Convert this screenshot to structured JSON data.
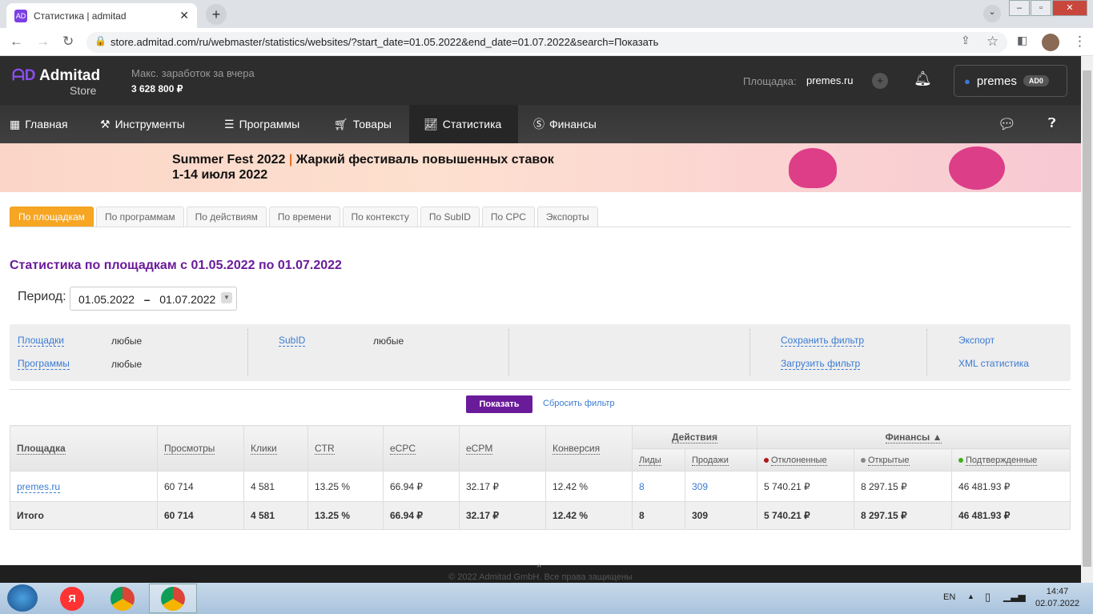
{
  "browser": {
    "tab_title": "Статистика | admitad",
    "url": "store.admitad.com/ru/webmaster/statistics/websites/?start_date=01.05.2022&end_date=01.07.2022&search=Показать"
  },
  "header": {
    "logo": "Admitad",
    "logo_sub": "Store",
    "earn_label": "Макс. заработок за вчера",
    "earn_value": "3 628 800 ₽",
    "site_label": "Площадка:",
    "site_value": "premes.ru",
    "user": "premes",
    "badge": "AD0"
  },
  "nav": [
    {
      "label": "Главная"
    },
    {
      "label": "Инструменты"
    },
    {
      "label": "Программы"
    },
    {
      "label": "Товары"
    },
    {
      "label": "Статистика"
    },
    {
      "label": "Финансы"
    }
  ],
  "banner": {
    "line1a": "Summer Fest 2022",
    "sep": " | ",
    "line1b": "Жаркий фестиваль повышенных ставок",
    "line2": "1-14 июля 2022"
  },
  "tabs": [
    "По площадкам",
    "По программам",
    "По действиям",
    "По времени",
    "По контексту",
    "По SubID",
    "По CPC",
    "Экспорты"
  ],
  "page_title": "Статистика по площадкам с 01.05.2022 по 01.07.2022",
  "period": {
    "label": "Период:",
    "from": "01.05.2022",
    "dash": "–",
    "to": "01.07.2022"
  },
  "filter": {
    "sites": "Площадки",
    "sites_val": "любые",
    "programs": "Программы",
    "programs_val": "любые",
    "subid": "SubID",
    "subid_val": "любые",
    "save": "Сохранить фильтр",
    "load": "Загрузить фильтр",
    "export": "Экспорт",
    "xml": "XML статистика"
  },
  "buttons": {
    "show": "Показать",
    "reset": "Сбросить фильтр"
  },
  "table": {
    "headers": {
      "site": "Площадка",
      "views": "Просмотры",
      "clicks": "Клики",
      "ctr": "CTR",
      "ecpc": "eCPC",
      "ecpm": "eCPM",
      "conv": "Конверсия",
      "actions": "Действия",
      "finance": "Финансы ▲",
      "leads": "Лиды",
      "sales": "Продажи",
      "rejected": "Отклоненные",
      "open": "Открытые",
      "confirmed": "Подтвержденные"
    },
    "rows": [
      {
        "site": "premes.ru",
        "views": "60 714",
        "clicks": "4 581",
        "ctr": "13.25 %",
        "ecpc": "66.94 ₽",
        "ecpm": "32.17 ₽",
        "conv": "12.42 %",
        "leads": "8",
        "sales": "309",
        "rejected": "5 740.21 ₽",
        "open": "8 297.15 ₽",
        "confirmed": "46 481.93 ₽"
      }
    ],
    "total": {
      "site": "Итого",
      "views": "60 714",
      "clicks": "4 581",
      "ctr": "13.25 %",
      "ecpc": "66.94 ₽",
      "ecpm": "32.17 ₽",
      "conv": "12.42 %",
      "leads": "8",
      "sales": "309",
      "rejected": "5 740.21 ₽",
      "open": "8 297.15 ₽",
      "confirmed": "46 481.93 ₽"
    }
  },
  "footer": "© 2022 Admitad GmbH. Все права защищены",
  "taskbar": {
    "lang": "EN",
    "time": "14:47",
    "date": "02.07.2022"
  }
}
